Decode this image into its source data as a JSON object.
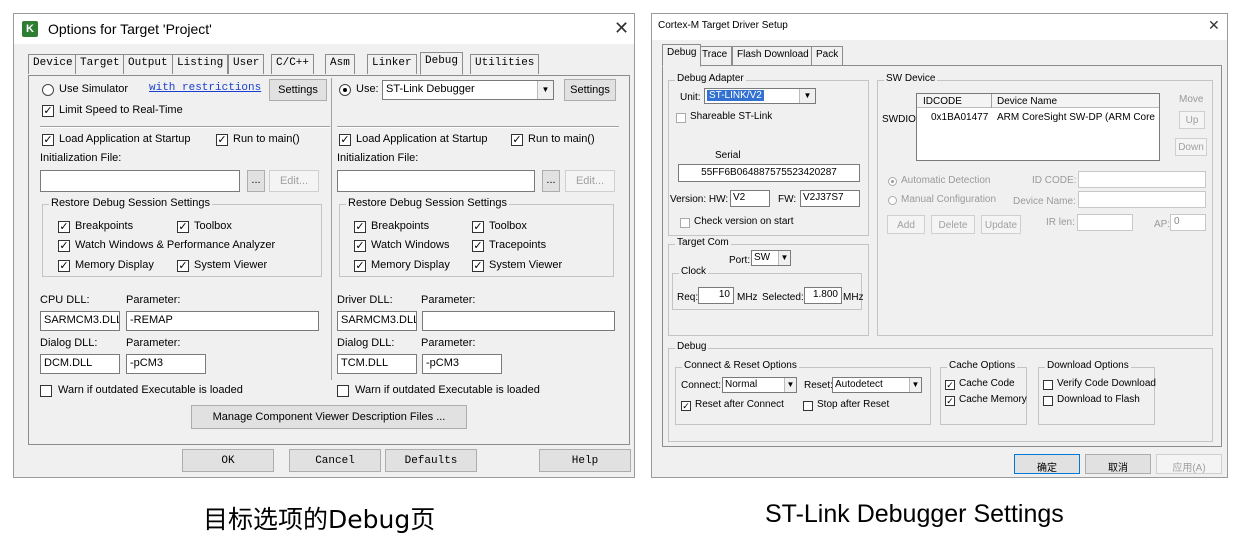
{
  "left": {
    "title": "Options for Target 'Project'",
    "tabs": [
      "Device",
      "Target",
      "Output",
      "Listing",
      "User",
      "C/C++",
      "Asm",
      "Linker",
      "Debug",
      "Utilities"
    ],
    "active_tab": "Debug",
    "sim": {
      "radio": "Use Simulator",
      "link": "with restrictions",
      "settings": "Settings",
      "limit_speed": "Limit Speed to Real-Time",
      "load_app": "Load Application at Startup",
      "run_main": "Run to main()",
      "init_file": "Initialization File:",
      "edit": "Edit...",
      "ellipsis": "...",
      "restore_title": "Restore Debug Session Settings",
      "breakpoints": "Breakpoints",
      "toolbox": "Toolbox",
      "watch": "Watch Windows & Performance Analyzer",
      "memory": "Memory Display",
      "sysview": "System Viewer",
      "dll_label": "CPU DLL:",
      "param_label": "Parameter:",
      "dll_value": "SARMCM3.DLL",
      "param_value": "-REMAP",
      "dialog_dll_label": "Dialog DLL:",
      "dialog_param_label": "Parameter:",
      "dialog_dll_value": "DCM.DLL",
      "dialog_param_value": "-pCM3",
      "warn": "Warn if outdated Executable is loaded"
    },
    "tgt": {
      "use_label": "Use:",
      "debugger": "ST-Link Debugger",
      "settings": "Settings",
      "load_app": "Load Application at Startup",
      "run_main": "Run to main()",
      "init_file": "Initialization File:",
      "edit": "Edit...",
      "ellipsis": "...",
      "restore_title": "Restore Debug Session Settings",
      "breakpoints": "Breakpoints",
      "toolbox": "Toolbox",
      "watch": "Watch Windows",
      "tracepoints": "Tracepoints",
      "memory": "Memory Display",
      "sysview": "System Viewer",
      "dll_label": "Driver DLL:",
      "param_label": "Parameter:",
      "dll_value": "SARMCM3.DLL",
      "param_value": "",
      "dialog_dll_label": "Dialog DLL:",
      "dialog_param_label": "Parameter:",
      "dialog_dll_value": "TCM.DLL",
      "dialog_param_value": "-pCM3",
      "warn": "Warn if outdated Executable is loaded"
    },
    "manage_btn": "Manage Component Viewer Description Files ...",
    "buttons": {
      "ok": "OK",
      "cancel": "Cancel",
      "defaults": "Defaults",
      "help": "Help"
    }
  },
  "right": {
    "title": "Cortex-M Target Driver Setup",
    "tabs": [
      "Debug",
      "Trace",
      "Flash Download",
      "Pack"
    ],
    "active_tab": "Debug",
    "debug_adapter": {
      "title": "Debug Adapter",
      "unit_label": "Unit:",
      "unit_value": "ST-LINK/V2",
      "shareable": "Shareable ST-Link",
      "serial_label": "Serial",
      "serial_value": "55FF6B064887575523420287",
      "version_label": "Version: HW:",
      "hw_value": "V2",
      "fw_label": "FW:",
      "fw_value": "V2J37S7",
      "check_version": "Check version on start"
    },
    "sw_device": {
      "title": "SW Device",
      "col_idcode": "IDCODE",
      "col_name": "Device Name",
      "row_label": "SWDIO",
      "row_idcode": "0x1BA01477",
      "row_name": "ARM CoreSight SW-DP (ARM Core",
      "move": "Move",
      "up": "Up",
      "down": "Down",
      "auto_detect": "Automatic Detection",
      "manual_config": "Manual Configuration",
      "id_code_label": "ID CODE:",
      "device_name_label": "Device Name:",
      "add": "Add",
      "delete": "Delete",
      "update": "Update",
      "ir_len_label": "IR len:",
      "ap_label": "AP:",
      "ap_value": "0"
    },
    "target_com": {
      "title": "Target Com",
      "port_label": "Port:",
      "port_value": "SW",
      "clock_title": "Clock",
      "req_label": "Req:",
      "req_value": "10",
      "mhz1": "MHz",
      "selected_label": "Selected:",
      "selected_value": "1.800",
      "mhz2": "MHz"
    },
    "debug": {
      "title": "Debug",
      "connect_title": "Connect & Reset Options",
      "connect_label": "Connect:",
      "connect_value": "Normal",
      "reset_label": "Reset:",
      "reset_value": "Autodetect",
      "reset_after_connect": "Reset after Connect",
      "stop_after_reset": "Stop after Reset",
      "cache_title": "Cache Options",
      "cache_code": "Cache Code",
      "cache_memory": "Cache Memory",
      "download_title": "Download Options",
      "verify_code": "Verify Code Download",
      "download_flash": "Download to Flash"
    },
    "buttons": {
      "ok": "确定",
      "cancel": "取消",
      "apply": "应用(A)"
    }
  },
  "captions": {
    "left": "目标选项的Debug页",
    "right": "ST-Link Debugger Settings"
  }
}
